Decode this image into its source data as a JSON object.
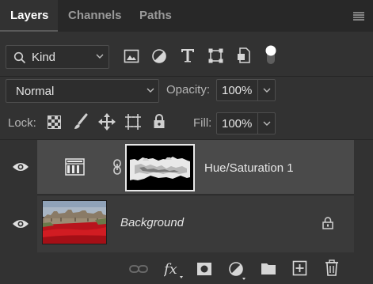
{
  "tabs": [
    {
      "label": "Layers",
      "active": true
    },
    {
      "label": "Channels",
      "active": false
    },
    {
      "label": "Paths",
      "active": false
    }
  ],
  "filter": {
    "value": "Kind"
  },
  "blend": {
    "value": "Normal"
  },
  "opacity": {
    "label": "Opacity:",
    "value": "100%"
  },
  "lock": {
    "label": "Lock:"
  },
  "fill": {
    "label": "Fill:",
    "value": "100%"
  },
  "layers": [
    {
      "name": "Hue/Saturation 1",
      "type": "adjustment",
      "selected": true,
      "visible": true
    },
    {
      "name": "Background",
      "type": "pixel",
      "locked": true,
      "visible": true
    }
  ],
  "colors": {
    "panel_bg": "#323232",
    "tabbar_bg": "#282828",
    "selected_row": "#4a4a4a",
    "row": "#3a3a3a"
  }
}
